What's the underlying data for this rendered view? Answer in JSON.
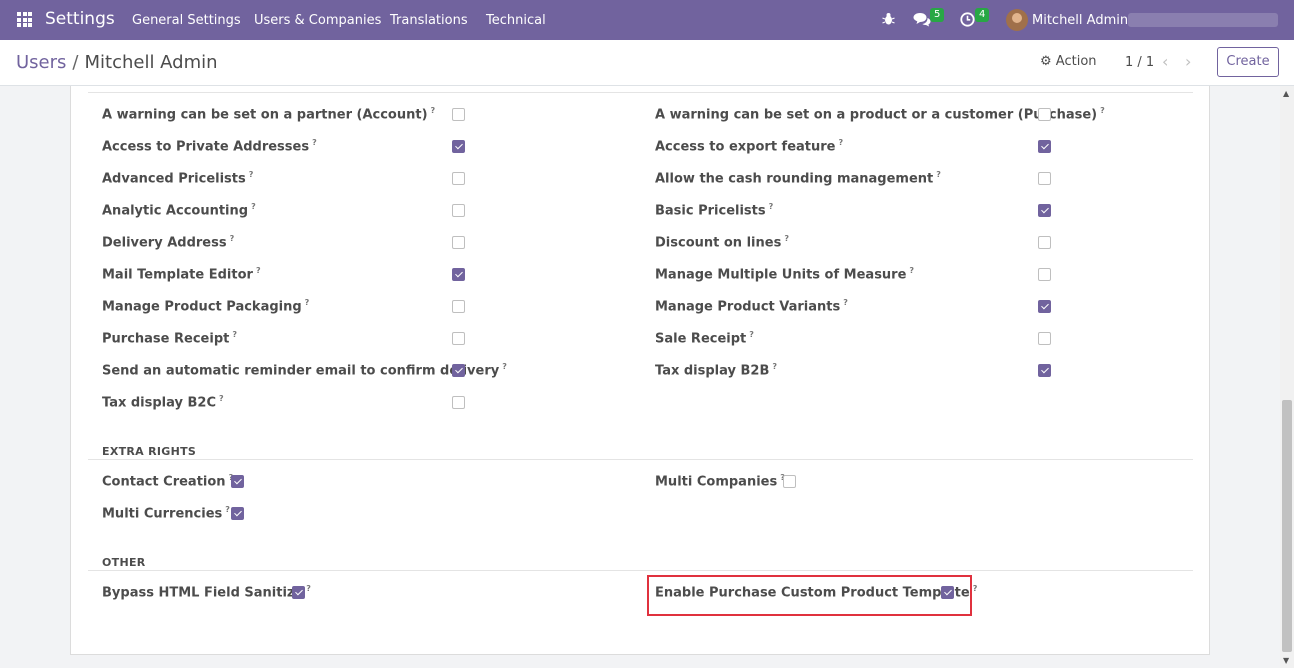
{
  "navbar": {
    "brand": "Settings",
    "menu": [
      "General Settings",
      "Users & Companies",
      "Translations",
      "Technical"
    ],
    "messages_count": "5",
    "activities_count": "4",
    "user_name": "Mitchell Admin"
  },
  "control_panel": {
    "breadcrumb_parent": "Users",
    "breadcrumb_separator": "/",
    "breadcrumb_current": "Mitchell Admin",
    "action_label": "Action",
    "pager_value": "1 / 1",
    "create_label": "Create"
  },
  "technical": {
    "left": [
      {
        "label": "A warning can be set on a partner (Account)",
        "checked": false
      },
      {
        "label": "Access to Private Addresses",
        "checked": true
      },
      {
        "label": "Advanced Pricelists",
        "checked": false
      },
      {
        "label": "Analytic Accounting",
        "checked": false
      },
      {
        "label": "Delivery Address",
        "checked": false
      },
      {
        "label": "Mail Template Editor",
        "checked": true
      },
      {
        "label": "Manage Product Packaging",
        "checked": false
      },
      {
        "label": "Purchase Receipt",
        "checked": false
      },
      {
        "label": "Send an automatic reminder email to confirm delivery",
        "checked": true
      },
      {
        "label": "Tax display B2C",
        "checked": false
      }
    ],
    "right": [
      {
        "label": "A warning can be set on a product or a customer (Purchase)",
        "checked": false
      },
      {
        "label": "Access to export feature",
        "checked": true
      },
      {
        "label": "Allow the cash rounding management",
        "checked": false
      },
      {
        "label": "Basic Pricelists",
        "checked": true
      },
      {
        "label": "Discount on lines",
        "checked": false
      },
      {
        "label": "Manage Multiple Units of Measure",
        "checked": false
      },
      {
        "label": "Manage Product Variants",
        "checked": true
      },
      {
        "label": "Sale Receipt",
        "checked": false
      },
      {
        "label": "Tax display B2B",
        "checked": true
      }
    ]
  },
  "extra_rights": {
    "title": "EXTRA RIGHTS",
    "contact_creation": {
      "label": "Contact Creation",
      "checked": true
    },
    "multi_currencies": {
      "label": "Multi Currencies",
      "checked": true
    },
    "multi_companies": {
      "label": "Multi Companies",
      "checked": false
    }
  },
  "other": {
    "title": "OTHER",
    "bypass_html": {
      "label": "Bypass HTML Field Sanitize",
      "checked": true
    },
    "purchase_template": {
      "label": "Enable Purchase Custom Product Template",
      "checked": true
    }
  },
  "help_mark": "?",
  "colors": {
    "brand": "#71639e",
    "badge": "#28a745",
    "highlight": "#e0313e"
  }
}
